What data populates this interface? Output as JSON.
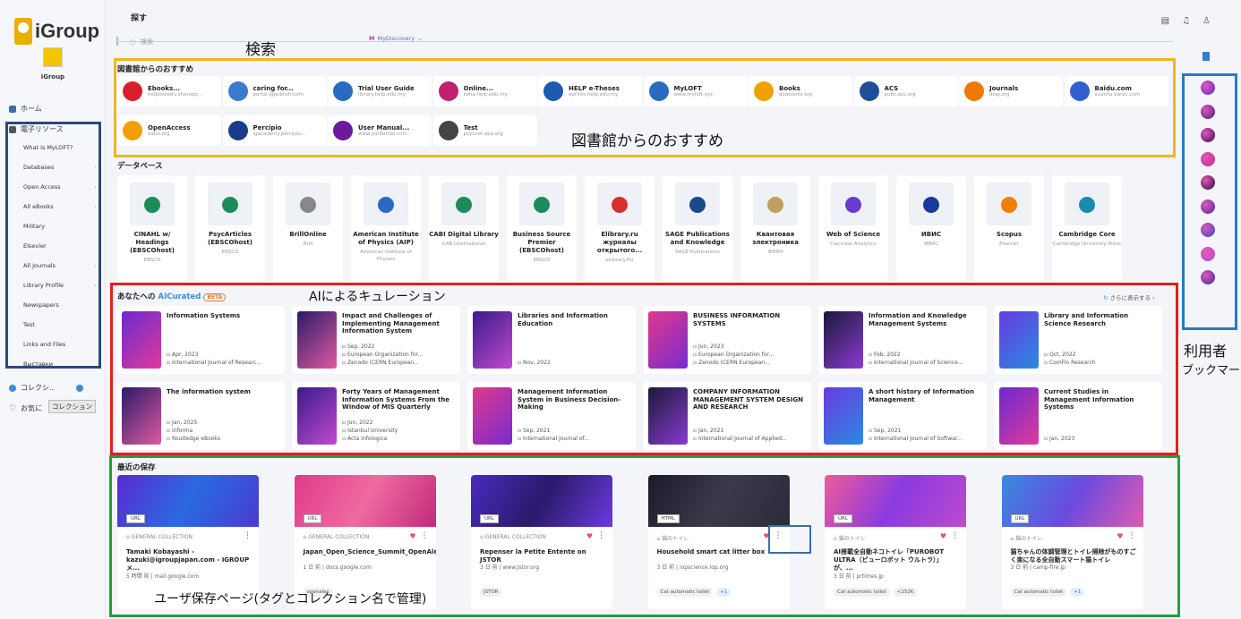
{
  "sidebar": {
    "logo": "iGroup",
    "org_name": "iGroup",
    "home": "ホーム",
    "eresources": "電子リソース",
    "sub_items": [
      "What is MyLOFT?",
      "Databases",
      "Open Access",
      "All eBooks",
      "Military",
      "Elsevier",
      "All Journals",
      "Library Profile",
      "Newspapers",
      "Test",
      "Links and Files",
      "Выставки"
    ],
    "collections": "コレクシ..",
    "favorites": "お気に",
    "tooltip": "コレクション"
  },
  "top": {
    "title": "探す",
    "search_placeholder": "検索",
    "source": "MyDiscovery"
  },
  "recommend": {
    "title": "図書館からのおすすめ",
    "items": [
      {
        "name": "Ebooks...",
        "url": "helpliveedu.sharepo...",
        "color": "#d81f2a"
      },
      {
        "name": "caring for...",
        "url": "portal.igpublish.com",
        "color": "#3a7bd0"
      },
      {
        "name": "Trial User Guide",
        "url": "library.help.edu.my",
        "color": "#2a6bc2"
      },
      {
        "name": "Online...",
        "url": "koha.help.edu.my",
        "color": "#c0206e"
      },
      {
        "name": "HELP e-Theses",
        "url": "eprints.help.edu.my",
        "color": "#1b5cb0"
      },
      {
        "name": "MyLOFT",
        "url": "www.myloft.xyz",
        "color": "#2a6bc2"
      },
      {
        "name": "Books",
        "url": "doabooks.org",
        "color": "#f0a000"
      },
      {
        "name": "ACS",
        "url": "pubs.acs.org",
        "color": "#1e4f9a"
      },
      {
        "name": "Journals",
        "url": "doaj.org",
        "color": "#f07800"
      },
      {
        "name": "Baidu.com",
        "url": "xueshu.baidu.com",
        "color": "#3060d0"
      },
      {
        "name": "OpenAccess",
        "url": "oabd.org",
        "color": "#f0a000"
      },
      {
        "name": "Percipio",
        "url": "igacademy.percipio...",
        "color": "#1a3a8a"
      },
      {
        "name": "User Manual...",
        "url": "www.yordambt.com",
        "color": "#6a1a9a"
      },
      {
        "name": "Test",
        "url": "psycnet.apa.org",
        "color": "#444444"
      }
    ]
  },
  "databases": {
    "title": "データベース",
    "items": [
      {
        "name": "CINAHL w/ Headings (EBSCOhost)",
        "pub": "EBSCO",
        "color": "#1e8c5a"
      },
      {
        "name": "PsycArticles (EBSCOhost)",
        "pub": "EBSCO",
        "color": "#1e8c5a"
      },
      {
        "name": "BrillOnline",
        "pub": "Brill",
        "color": "#888888"
      },
      {
        "name": "American Institute of Physics (AIP)",
        "pub": "American Institute of Physics",
        "color": "#2a6bc2"
      },
      {
        "name": "CABI Digital Library",
        "pub": "CAB International",
        "color": "#1e8c5a"
      },
      {
        "name": "Business Source Premier (EBSCOhost)",
        "pub": "EBSCO",
        "color": "#1e8c5a"
      },
      {
        "name": "Elibrary.ru журналы открытого...",
        "pub": "eLibrary.RU",
        "color": "#d83030"
      },
      {
        "name": "SAGE Publications and Knowledge",
        "pub": "SAGE Publications",
        "color": "#1a4a8a"
      },
      {
        "name": "Квантовая электроника",
        "pub": "ФИАН",
        "color": "#c0a060"
      },
      {
        "name": "Web of Science",
        "pub": "Clarivate Analytics",
        "color": "#6a3ad0"
      },
      {
        "name": "ИВИС",
        "pub": "ИВИС",
        "color": "#1a3a9a"
      },
      {
        "name": "Scopus",
        "pub": "Elsevier",
        "color": "#f08000"
      },
      {
        "name": "Cambridge Core",
        "pub": "Cambridge University Press",
        "color": "#1a8ab0"
      }
    ]
  },
  "ai": {
    "title_prefix": "あなたへの",
    "title_ai": "AICurated",
    "beta": "BETA",
    "more": "さらに表示する",
    "items": [
      {
        "title": "Information Systems",
        "date": "Apr, 2023",
        "src": "International Journal of Researc...",
        "org": ""
      },
      {
        "title": "Impact and Challenges of Implementing Management Information System",
        "date": "Sep, 2022",
        "src": "European Organization for...",
        "org": "Zenodo (CERN European..."
      },
      {
        "title": "Libraries and Information Education",
        "date": "Nov, 2022",
        "src": "",
        "org": ""
      },
      {
        "title": "BUSINESS INFORMATION SYSTEMS",
        "date": "Jun, 2023",
        "src": "European Organization for...",
        "org": "Zenodo (CERN European..."
      },
      {
        "title": "Information and Knowledge Management Systems",
        "date": "Feb, 2022",
        "src": "International Journal of Science...",
        "org": ""
      },
      {
        "title": "Library and Information Science Research",
        "date": "Oct, 2022",
        "src": "ComFin Research",
        "org": ""
      },
      {
        "title": "The information system",
        "date": "Jan, 2025",
        "src": "Informa",
        "org": "Routledge eBooks"
      },
      {
        "title": "Forty Years of Management Information Systems From the Window of MIS Quarterly",
        "date": "Jun, 2022",
        "src": "Istanbul University",
        "org": "Acta Infologica"
      },
      {
        "title": "Management Information System in Business Decision-Making",
        "date": "Sep, 2021",
        "src": "International Journal of...",
        "org": ""
      },
      {
        "title": "COMPANY INFORMATION MANAGEMENT SYSTEM DESIGN AND RESEARCH",
        "date": "Jan, 2021",
        "src": "International Journal of Applied...",
        "org": ""
      },
      {
        "title": "A short history of Information Management",
        "date": "Sep, 2021",
        "src": "International Journal of Softwar...",
        "org": ""
      },
      {
        "title": "Current Studies in Management Information Systems",
        "date": "Jan, 2023",
        "src": "",
        "org": ""
      }
    ]
  },
  "saved": {
    "title": "最近の保存",
    "items": [
      {
        "tag": "URL",
        "coll": "GENERAL COLLECTION",
        "title": "Tamaki Kobayashi - kazuki@igroupjapan.com - IGROUP メ...",
        "meta": "5 時間 前 | mail.google.com",
        "tags": [],
        "heart": false
      },
      {
        "tag": "URL",
        "coll": "GENERAL COLLECTION",
        "title": "Japan_Open_Science_Summit_OpenAlex#1",
        "meta": "1 日 前 | docs.google.com",
        "tags": [
          "openalex"
        ],
        "heart": true
      },
      {
        "tag": "URL",
        "coll": "GENERAL COLLECTION",
        "title": "Repenser la Petite Entente on JSTOR",
        "meta": "3 日 前 | www.jstor.org",
        "tags": [
          "JSTOR"
        ],
        "heart": true
      },
      {
        "tag": "HTML",
        "coll": "猫のトイレ",
        "title": "Household smart cat litter box",
        "meta": "3 日 前 | iopscience.iop.org",
        "tags": [
          "Cat automatic toilet",
          "+1"
        ],
        "heart": true
      },
      {
        "tag": "URL",
        "coll": "猫のトイレ",
        "title": "AI搭載全自動ネコトイレ「PUROBOT ULTRA（ピューロボット ウルトラ）」が、...",
        "meta": "3 日 前 | prtimes.jp",
        "tags": [
          "Cat automatic toilet",
          "<152K"
        ],
        "heart": true
      },
      {
        "tag": "URL",
        "coll": "猫のトイレ",
        "title": "猫ちゃんの体調管理とトイレ掃除がものすごく楽になる全自動スマート猫トイレ",
        "meta": "3 日 前 | camp-fire.jp",
        "tags": [
          "Cat automatic toilet",
          "+1"
        ],
        "heart": true
      }
    ]
  },
  "annotations": {
    "search": "検索",
    "recommend": "図書館からのおすすめ",
    "ai": "AIによるキュレーション",
    "saved": "ユーザ保存ページ(タグとコレクション名で管理)",
    "right1": "利用者",
    "right2": "ブックマー"
  }
}
